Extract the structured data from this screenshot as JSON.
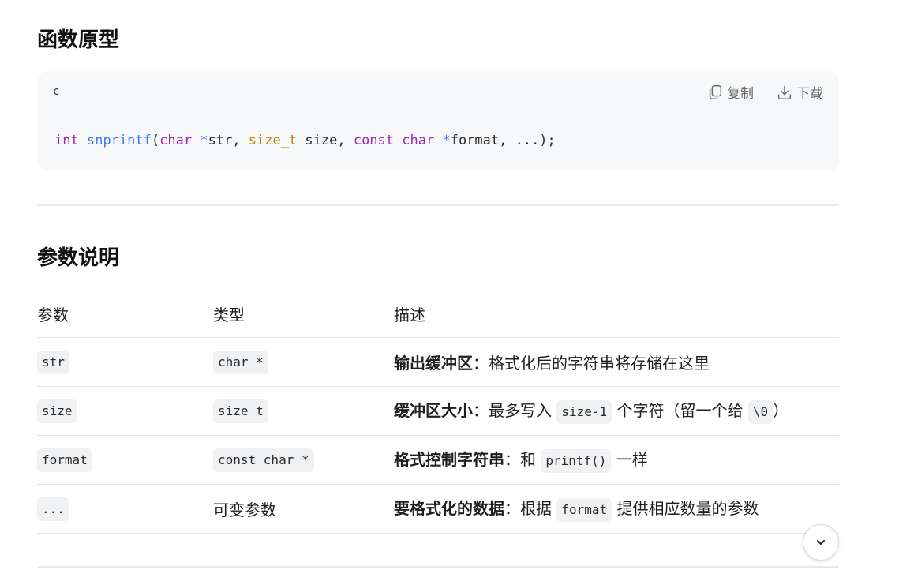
{
  "sections": {
    "prototype_title": "函数原型",
    "params_title": "参数说明"
  },
  "codeblock": {
    "language": "c",
    "copy_label": "复制",
    "download_label": "下载",
    "tokens": {
      "t1": "int",
      "t2": " ",
      "t3": "snprintf",
      "t4": "(",
      "t5": "char",
      "t6": " ",
      "t7": "*",
      "t8": "str, ",
      "t9": "size_t",
      "t10": " size, ",
      "t11": "const",
      "t12": " ",
      "t13": "char",
      "t14": " ",
      "t15": "*",
      "t16": "format, ...);"
    }
  },
  "table": {
    "headers": [
      "参数",
      "类型",
      "描述"
    ],
    "rows": [
      {
        "param": "str",
        "type": "char *",
        "desc_bold": "输出缓冲区",
        "desc_parts": [
          "：格式化后的字符串将存储在这里"
        ]
      },
      {
        "param": "size",
        "type": "size_t",
        "desc_bold": "缓冲区大小",
        "desc_parts": [
          "：最多写入 ",
          "size-1",
          " 个字符（留一个给 ",
          "\\0",
          "）"
        ]
      },
      {
        "param": "format",
        "type": "const char *",
        "desc_bold": "格式控制字符串",
        "desc_parts": [
          "：和 ",
          "printf()",
          " 一样"
        ]
      },
      {
        "param": "...",
        "type": "可变参数",
        "desc_bold": "要格式化的数据",
        "desc_parts": [
          "：根据 ",
          "format",
          " 提供相应数量的参数"
        ]
      }
    ]
  },
  "icons": {
    "copy": "copy-icon",
    "download": "download-icon",
    "scroll": "chevron-down-icon"
  }
}
